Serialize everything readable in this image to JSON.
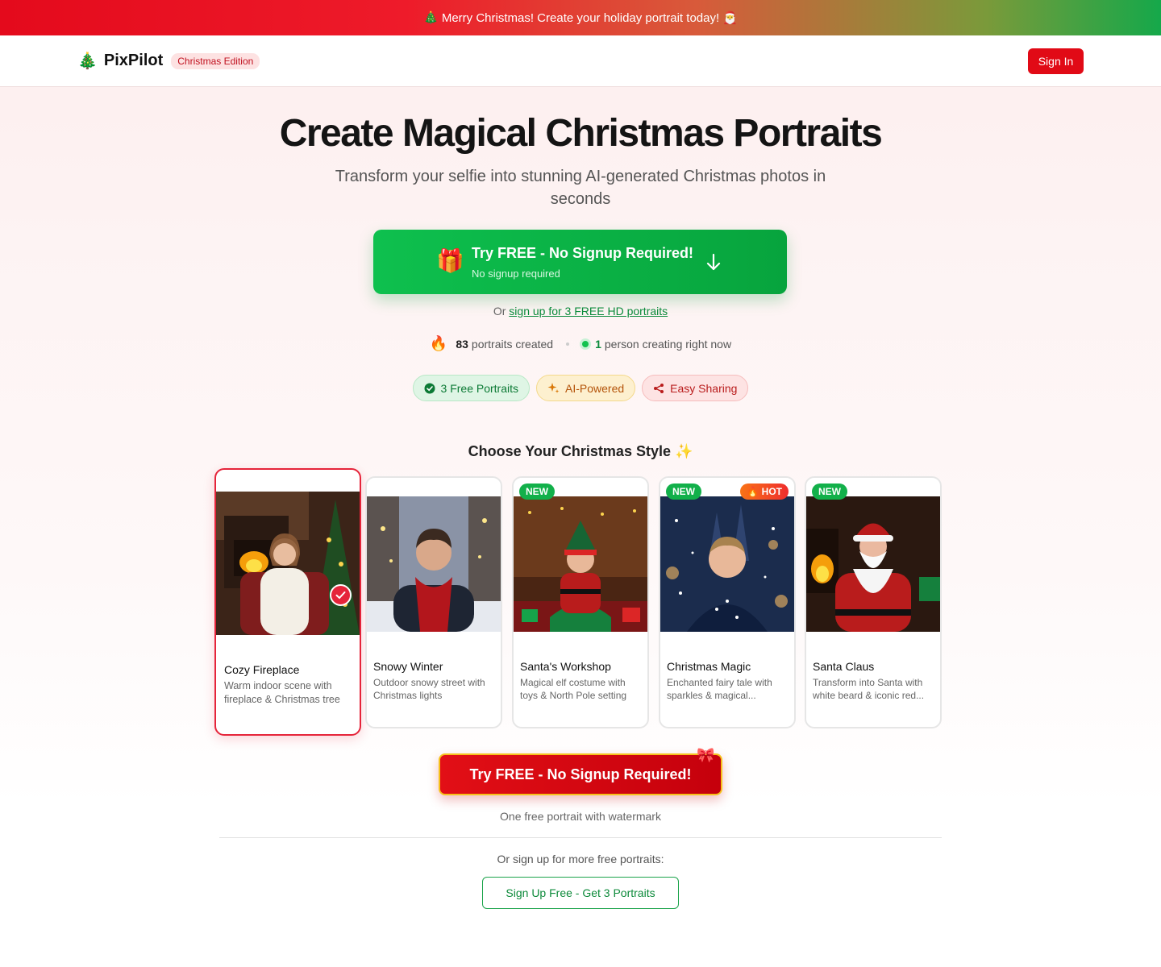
{
  "banner": {
    "text": "🎄 Merry Christmas! Create your holiday portrait today! 🎅"
  },
  "header": {
    "logo_icon": "🎄",
    "brand": "PixPilot",
    "edition": "Christmas Edition",
    "signin_label": "Sign In"
  },
  "hero": {
    "title": "Create Magical Christmas Portraits",
    "subtitle": "Transform your selfie into stunning AI-generated Christmas photos in seconds",
    "cta_icon": "🎁",
    "cta_title": "Try FREE - No Signup Required!",
    "cta_note": "No signup required",
    "or_prefix": "Or",
    "or_link": "sign up for 3 FREE HD portraits"
  },
  "stats": {
    "fire_icon": "🔥",
    "portraits_count": "83",
    "portraits_label": "portraits created",
    "live_count": "1",
    "live_label": "person creating right now"
  },
  "badges": [
    {
      "label": "3 Free Portraits",
      "icon": "check-circle-icon"
    },
    {
      "label": "AI-Powered",
      "icon": "sparkles-icon"
    },
    {
      "label": "Easy Sharing",
      "icon": "share-icon"
    }
  ],
  "styles_section": {
    "title": "Choose Your Christmas Style ✨",
    "cards": [
      {
        "name": "Cozy Fireplace",
        "desc": "Warm indoor scene with fireplace & Christmas tree",
        "selected": true
      },
      {
        "name": "Snowy Winter",
        "desc": "Outdoor snowy street with Christmas lights"
      },
      {
        "name": "Santa's Workshop",
        "desc": "Magical elf costume with toys & North Pole setting",
        "tag": "NEW"
      },
      {
        "name": "Christmas Magic",
        "desc": "Enchanted fairy tale with sparkles & magical...",
        "tag": "NEW",
        "tag2": "🔥 HOT"
      },
      {
        "name": "Santa Claus",
        "desc": "Transform into Santa with white beard & iconic red...",
        "tag": "NEW"
      }
    ]
  },
  "cta2": {
    "label": "Try FREE - No Signup Required!",
    "bow": "🎀"
  },
  "footer": {
    "free_note": "One free portrait with watermark",
    "more_note": "Or sign up for more free portraits:",
    "signup_label": "Sign Up Free - Get 3 Portraits"
  },
  "colors": {
    "brand_red": "#e10a16",
    "brand_green": "#0ec04e",
    "gold": "#f6c11c"
  }
}
